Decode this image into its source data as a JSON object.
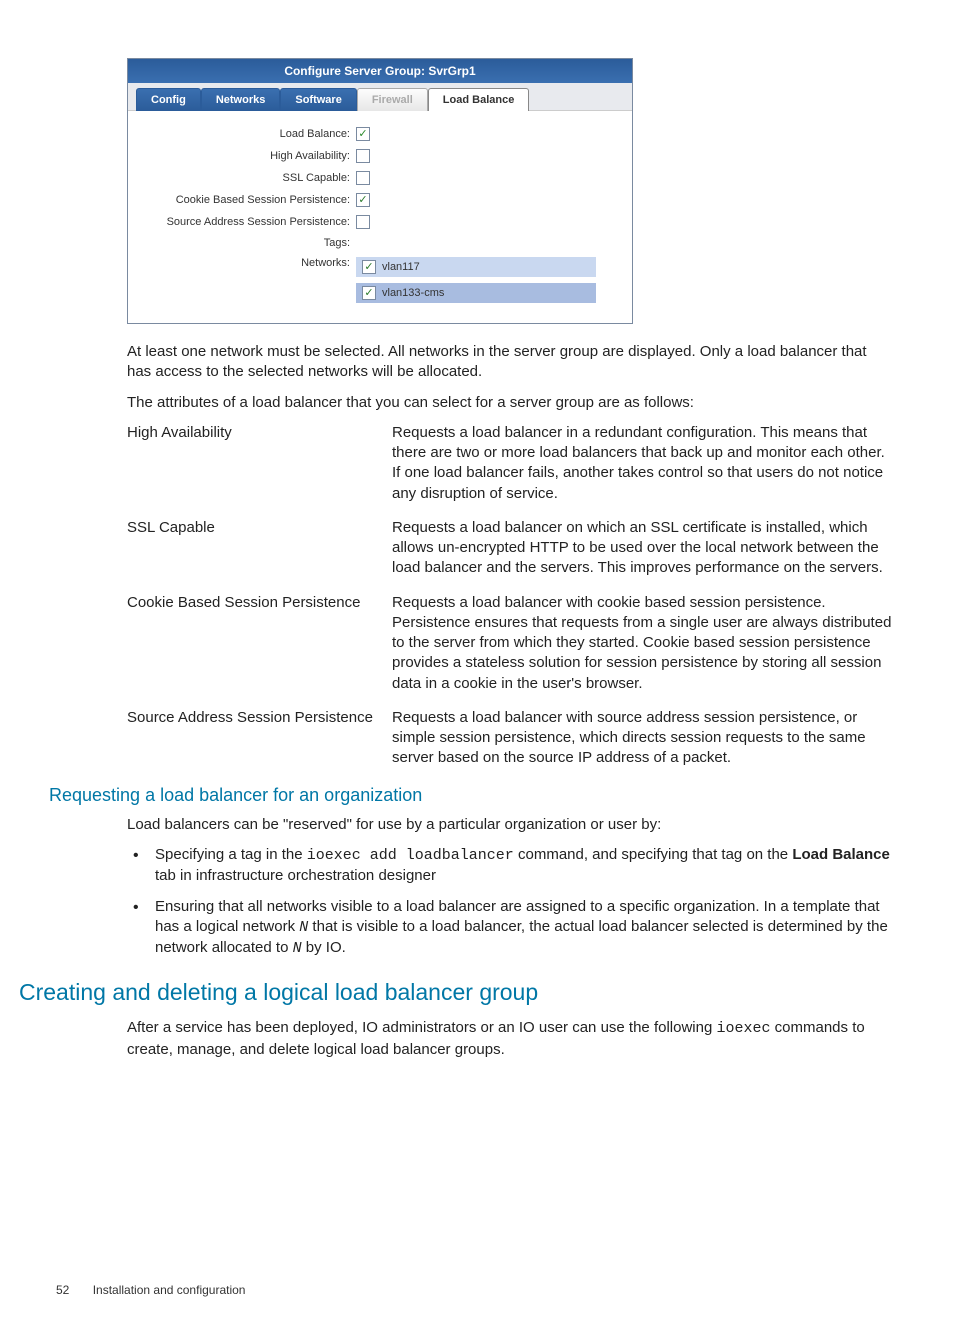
{
  "screenshot": {
    "title": "Configure Server Group: SvrGrp1",
    "tabs": {
      "config": "Config",
      "networks": "Networks",
      "software": "Software",
      "firewall": "Firewall",
      "loadbalance": "Load Balance"
    },
    "labels": {
      "lb": "Load Balance:",
      "ha": "High Availability:",
      "ssl": "SSL Capable:",
      "cookie": "Cookie Based Session Persistence:",
      "source": "Source Address Session Persistence:",
      "tags": "Tags:",
      "networks": "Networks:"
    },
    "checks": {
      "lb": "✓",
      "ha": "",
      "ssl": "",
      "cookie": "✓",
      "source": ""
    },
    "nets": {
      "n1": "vlan117",
      "n2": "vlan133-cms",
      "c1": "✓",
      "c2": "✓"
    }
  },
  "para1": "At least one network must be selected. All networks in the server group are displayed. Only a load balancer that has access to the selected networks will be allocated.",
  "para2": "The attributes of a load balancer that you can select for a server group are as follows:",
  "attrs": {
    "ha_t": "High Availability",
    "ha_d": "Requests a load balancer in a redundant configuration. This means that there are two or more load balancers that back up and monitor each other. If one load balancer fails, another takes control so that users do not notice any disruption of service.",
    "ssl_t": "SSL Capable",
    "ssl_d": "Requests a load balancer on which an SSL certificate is installed, which allows un-encrypted HTTP to be used over the local network between the load balancer and the servers. This improves performance on the servers.",
    "cookie_t": "Cookie Based Session Persistence",
    "cookie_d": "Requests a load balancer with cookie based session persistence. Persistence ensures that requests from a single user are always distributed to the server from which they started. Cookie based session persistence provides a stateless solution for session persistence by storing all session data in a cookie in the user's browser.",
    "src_t": "Source Address Session Persistence",
    "src_d": "Requests a load balancer with source address session persistence, or simple session persistence, which directs session requests to the same server based on the source IP address of a packet."
  },
  "h3": "Requesting a load balancer for an organization",
  "para3": "Load balancers can be \"reserved\" for use by a particular organization or user by:",
  "bul1_a": "Specifying a tag in the ",
  "bul1_code": "ioexec add loadbalancer",
  "bul1_b": " command, and specifying that tag on the ",
  "bul1_bold": "Load Balance",
  "bul1_c": " tab in infrastructure orchestration designer",
  "bul2_a": "Ensuring that all networks visible to a load balancer are assigned to a specific organization. In a template that has a logical network ",
  "bul2_n1": "N",
  "bul2_b": " that is visible to a load balancer, the actual load balancer selected is determined by the network allocated to ",
  "bul2_n2": "N",
  "bul2_c": " by IO.",
  "h2": "Creating and deleting a logical load balancer group",
  "para4_a": "After a service has been deployed, IO administrators or an IO user can use the following ",
  "para4_code": "ioexec",
  "para4_b": " commands to create, manage, and delete logical load balancer groups.",
  "footer": {
    "page": "52",
    "section": "Installation and configuration"
  }
}
